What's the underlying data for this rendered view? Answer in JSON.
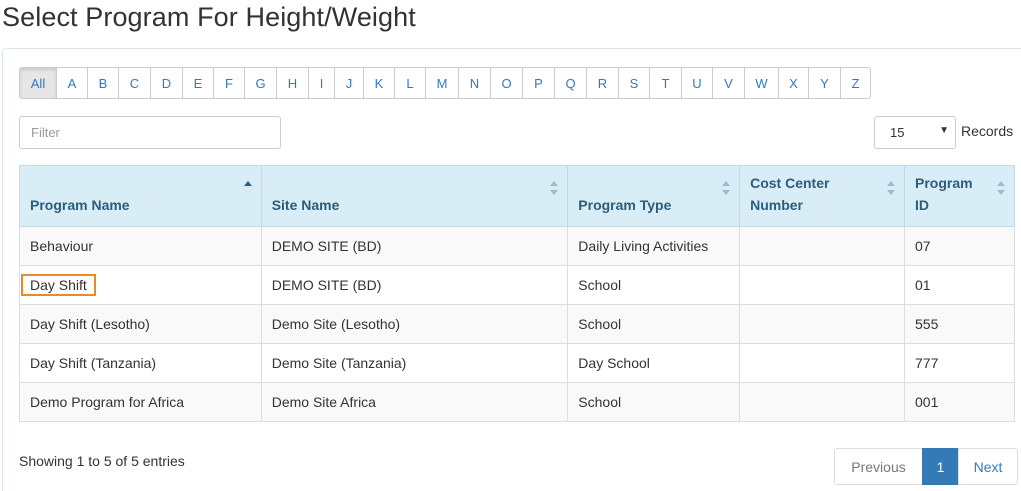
{
  "page": {
    "title": "Select Program For Height/Weight"
  },
  "alphabet": [
    "All",
    "A",
    "B",
    "C",
    "D",
    "E",
    "F",
    "G",
    "H",
    "I",
    "J",
    "K",
    "L",
    "M",
    "N",
    "O",
    "P",
    "Q",
    "R",
    "S",
    "T",
    "U",
    "V",
    "W",
    "X",
    "Y",
    "Z"
  ],
  "alphabet_active": "All",
  "filter": {
    "placeholder": "Filter",
    "value": ""
  },
  "records": {
    "selected": "15",
    "label": "Records"
  },
  "table": {
    "columns": [
      {
        "label": "Program Name",
        "sort": "asc"
      },
      {
        "label": "Site Name",
        "sort": "none"
      },
      {
        "label": "Program Type",
        "sort": "none"
      },
      {
        "label": "Cost Center Number",
        "sort": "none"
      },
      {
        "label": "Program ID",
        "sort": "none"
      }
    ],
    "rows": [
      [
        "Behaviour",
        "DEMO SITE (BD)",
        "Daily Living Activities",
        "",
        "07"
      ],
      [
        "Day Shift",
        "DEMO SITE (BD)",
        "School",
        "",
        "01"
      ],
      [
        "Day Shift (Lesotho)",
        "Demo Site (Lesotho)",
        "School",
        "",
        "555"
      ],
      [
        "Day Shift (Tanzania)",
        "Demo Site (Tanzania)",
        "Day School",
        "",
        "777"
      ],
      [
        "Demo Program for Africa",
        "Demo Site Africa",
        "School",
        "",
        "001"
      ]
    ],
    "highlighted_row": 1
  },
  "info": {
    "text": "Showing 1 to 5 of 5 entries"
  },
  "pagination": {
    "previous": "Previous",
    "current": "1",
    "next": "Next"
  },
  "colors": {
    "link": "#337ab7",
    "header_bg": "#d9edf7",
    "highlight_border": "#e8892a",
    "active_page": "#337ab7"
  }
}
